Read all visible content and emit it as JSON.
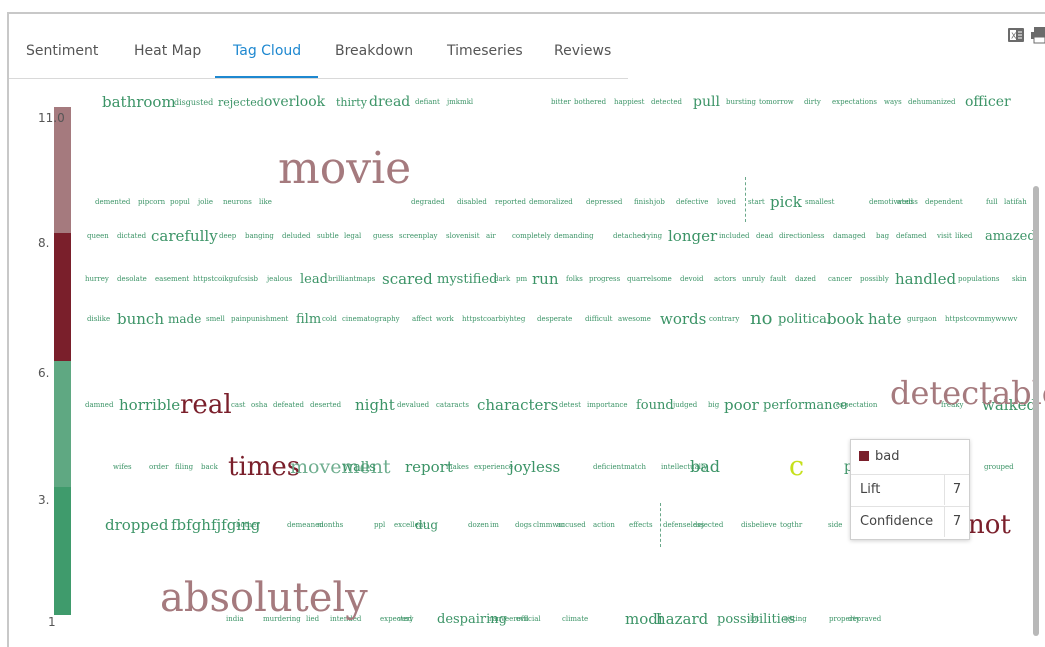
{
  "tabs": {
    "sentiment": "Sentiment",
    "heatmap": "Heat Map",
    "tagcloud": "Tag Cloud",
    "breakdown": "Breakdown",
    "timeseries": "Timeseries",
    "reviews": "Reviews"
  },
  "active_tab": "Tag Cloud",
  "icons": {
    "export_excel": "excel-icon",
    "print": "print-icon"
  },
  "legend_axis": {
    "top": "11.0",
    "t2": "8.",
    "t3": "6.",
    "t4": "3.",
    "bottom": "1"
  },
  "legend_colors": [
    "#a57a7e",
    "#7a1f2b",
    "#5fa882",
    "#3f9b6c"
  ],
  "tooltip": {
    "term": "bad",
    "swatch_color": "#7a1f2b",
    "lift_label": "Lift",
    "lift_value": "7",
    "confidence_label": "Confidence",
    "confidence_value": "7"
  },
  "cloud_words": [
    "bathroom",
    "disgusted",
    "rejected",
    "overlook",
    "thirty",
    "dread",
    "defiant",
    "jmkmkl",
    "bitter",
    "bothered",
    "happiest",
    "detected",
    "pull",
    "bursting",
    "tomorrow",
    "dirty",
    "expectations",
    "ways",
    "dehumanized",
    "officer",
    "movie",
    "demented",
    "pipcorn",
    "popul",
    "jolie",
    "neurons",
    "like",
    "degraded",
    "disabled",
    "reported",
    "demoralized",
    "depressed",
    "finish",
    "job",
    "defective",
    "loved",
    "start",
    "pick",
    "smallest",
    "demotivated",
    "wedss",
    "dependent",
    "full",
    "latifah",
    "queen",
    "dictated",
    "carefully",
    "deep",
    "banging",
    "deluded",
    "subtle",
    "legal",
    "guess",
    "screenplay",
    "slovenisit",
    "air",
    "completely",
    "demanding",
    "detached",
    "vying",
    "longer",
    "included",
    "dead",
    "directionless",
    "damaged",
    "bag",
    "defamed",
    "visit",
    "liked",
    "amazed",
    "hurrey",
    "desolate",
    "easement",
    "httpstcoikgufcsisb",
    "jealous",
    "lead",
    "brilliantmaps",
    "scared",
    "mystified",
    "dark",
    "pm",
    "run",
    "folks",
    "progress",
    "quarrelsome",
    "devoid",
    "actors",
    "unruly",
    "fault",
    "dazed",
    "cancer",
    "possibly",
    "handled",
    "populations",
    "skin",
    "dislike",
    "bunch",
    "made",
    "smell",
    "painpunishment",
    "film",
    "cold",
    "cinematography",
    "affect",
    "work",
    "httpstcoarbiyhteg",
    "desperate",
    "difficult",
    "awesome",
    "words",
    "contrary",
    "no",
    "political",
    "book",
    "hate",
    "gurgaon",
    "httpstcovmmywwwv",
    "so",
    "damned",
    "horrible",
    "real",
    "cast",
    "osha",
    "defeated",
    "deserted",
    "night",
    "devalued",
    "cataracts",
    "characters",
    "detest",
    "importance",
    "found",
    "judged",
    "big",
    "poor",
    "performance",
    "expectation",
    "detectable",
    "freaky",
    "walked",
    "wifes",
    "order",
    "filing",
    "back",
    "times",
    "movement",
    "walls",
    "report",
    "makes",
    "experience",
    "joyless",
    "deficient",
    "match",
    "intellectually",
    "bad",
    "c",
    "point",
    "grouped",
    "dropped",
    "fbfghfjfging",
    "bother",
    "demeaned",
    "months",
    "ppl",
    "excellent",
    "dug",
    "dozen",
    "im",
    "dogs",
    "clmmwm",
    "accused",
    "action",
    "effects",
    "defenseless",
    "dejected",
    "disbelieve",
    "togthr",
    "side",
    "not",
    "despised",
    "absolutely",
    "india",
    "murdering",
    "lied",
    "intended",
    "expected",
    "very",
    "despairing",
    "ranveerofficial",
    "evil",
    "climate",
    "modi",
    "hazard",
    "possibilities",
    "lot",
    "sitting",
    "property",
    "depraved"
  ]
}
